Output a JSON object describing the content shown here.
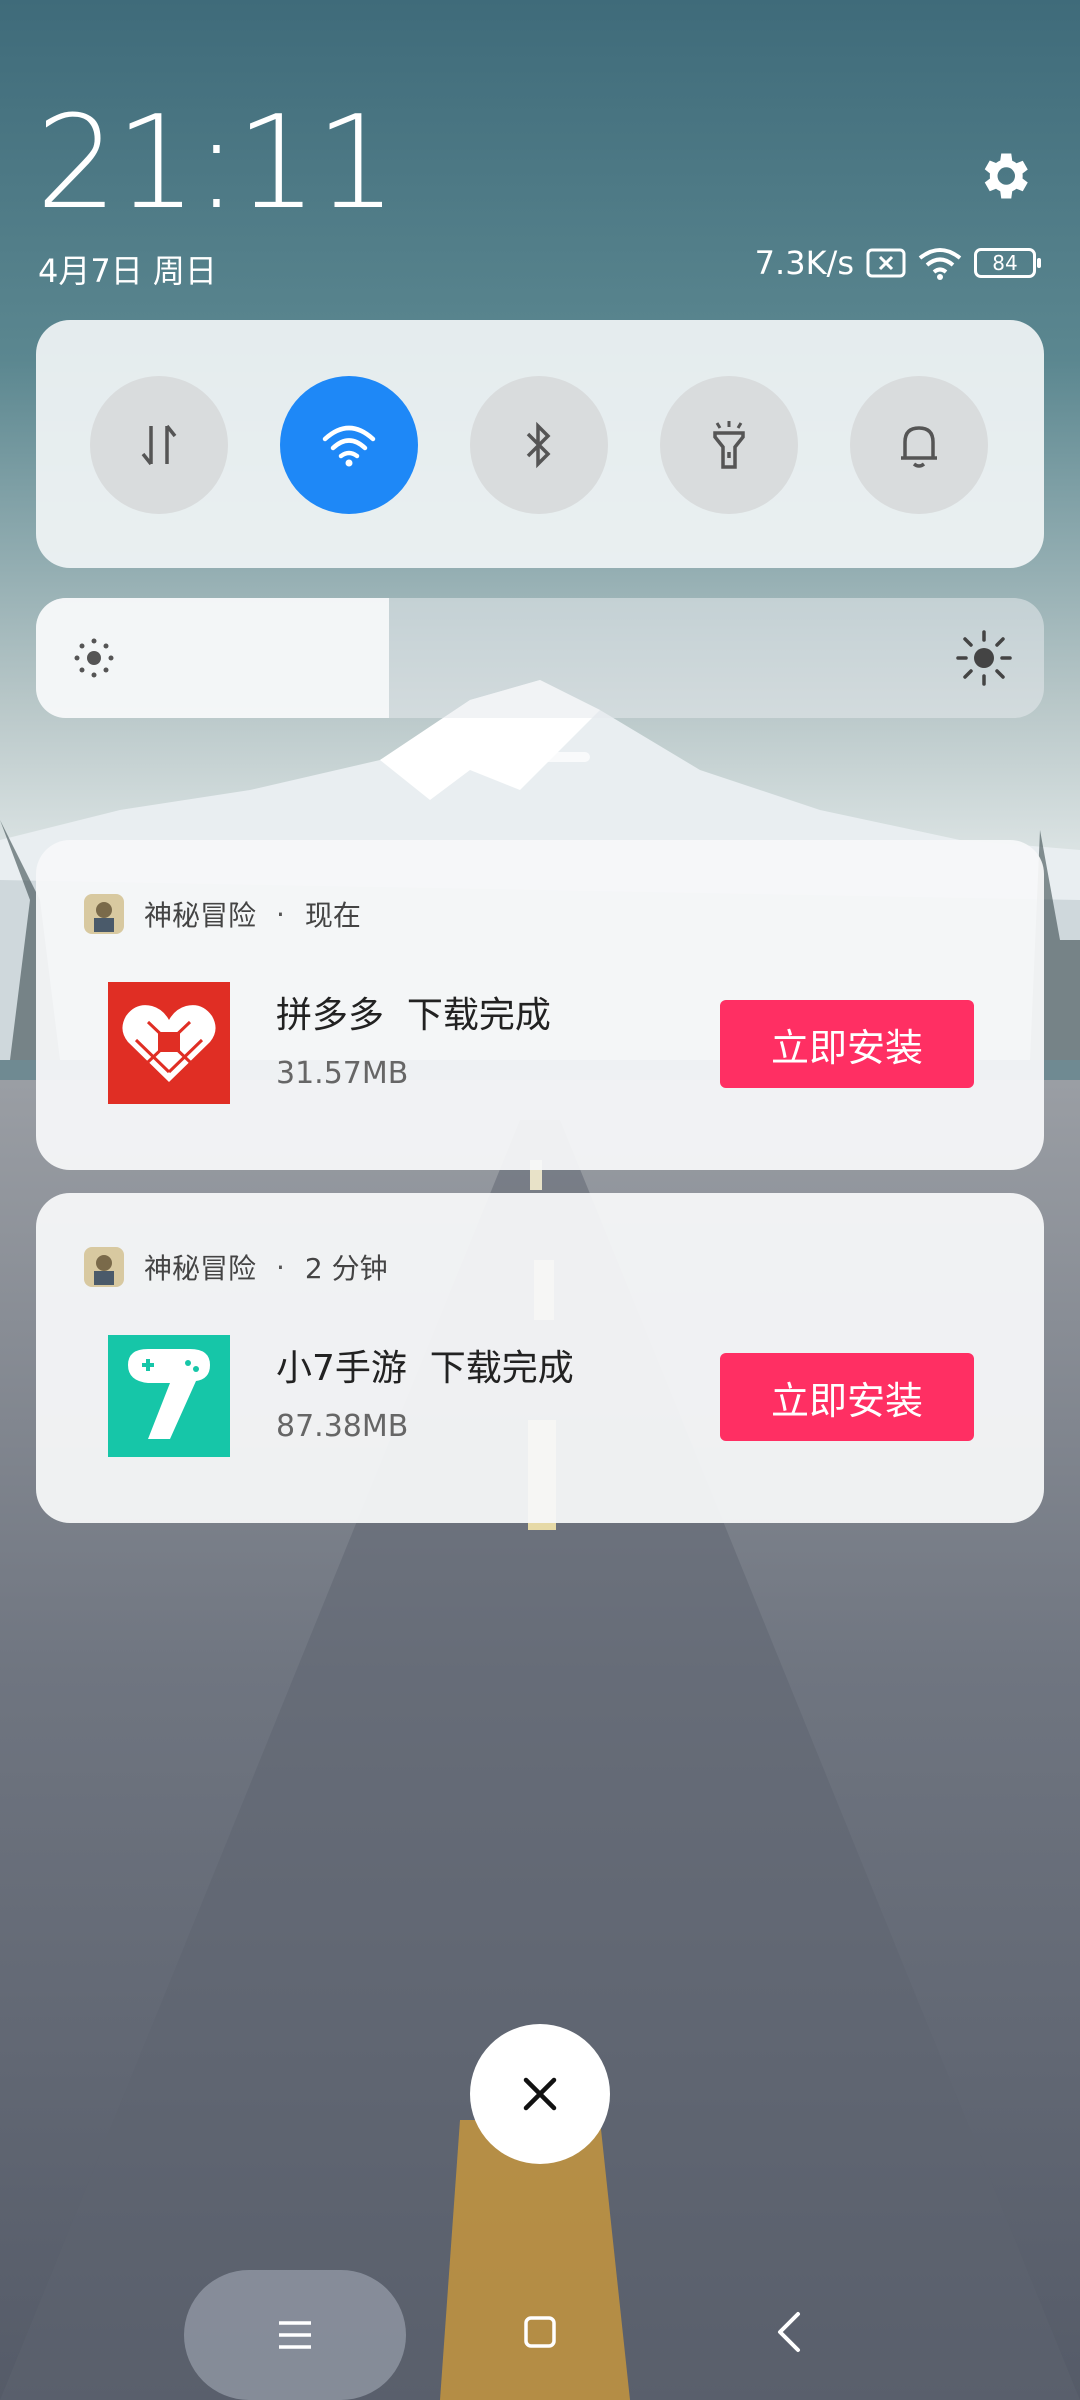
{
  "status": {
    "time": "21:11",
    "date": "4月7日 周日",
    "net_speed": "7.3K/s",
    "battery": "84"
  },
  "quick_toggles": [
    {
      "name": "mobile-data",
      "icon": "data-arrows-icon",
      "active": false
    },
    {
      "name": "wifi",
      "icon": "wifi-icon",
      "active": true
    },
    {
      "name": "bluetooth",
      "icon": "bluetooth-icon",
      "active": false
    },
    {
      "name": "flashlight",
      "icon": "flashlight-icon",
      "active": false
    },
    {
      "name": "ringer",
      "icon": "bell-icon",
      "active": false
    }
  ],
  "brightness": {
    "level": 0.35
  },
  "notifications": [
    {
      "source": "神秘冒险",
      "time": "现在",
      "app_name": "拼多多",
      "status": "下载完成",
      "size": "31.57MB",
      "action": "立即安装",
      "icon_color": "#e02e24"
    },
    {
      "source": "神秘冒险",
      "time": "2 分钟",
      "app_name": "小7手游",
      "status": "下载完成",
      "size": "87.38MB",
      "action": "立即安装",
      "icon_color": "#16c6a8"
    }
  ],
  "colors": {
    "accent": "#1e88f7",
    "install_button": "#ff2f63"
  }
}
